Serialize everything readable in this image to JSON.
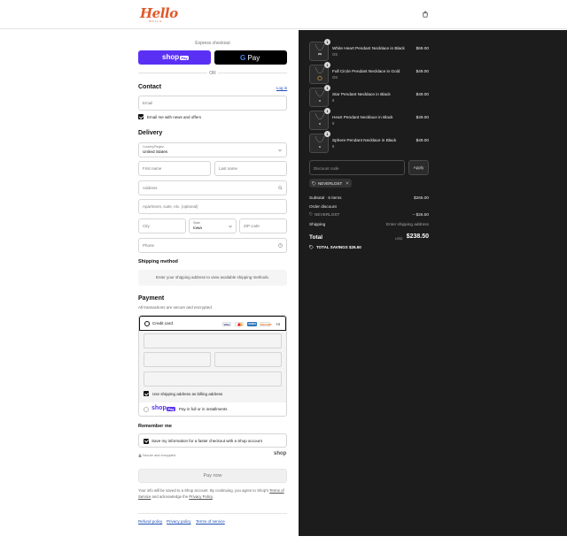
{
  "header": {
    "logo_text": "Hello",
    "logo_sub": "MOLLA",
    "cart_icon": "shopping-bag-icon"
  },
  "express": {
    "label": "Express checkout",
    "shop_label": "shop",
    "shop_chip": "Pay",
    "gpay_label": "Pay",
    "or_label": "OR"
  },
  "contact": {
    "title": "Contact",
    "login_link": "Log in",
    "email_placeholder": "Email",
    "newsletter_label": "Email me with news and offers"
  },
  "delivery": {
    "title": "Delivery",
    "country_label": "Country/Region",
    "country_value": "United States",
    "first_name_placeholder": "First name",
    "last_name_placeholder": "Last name",
    "address_placeholder": "Address",
    "apartment_placeholder": "Apartment, suite, etc. (optional)",
    "city_placeholder": "City",
    "state_label": "State",
    "state_value": "Iowa",
    "zip_placeholder": "ZIP code",
    "phone_placeholder": "Phone"
  },
  "shipping": {
    "title": "Shipping method",
    "message": "Enter your shipping address to view available shipping methods."
  },
  "payment": {
    "title": "Payment",
    "subtitle": "All transactions are secure and encrypted.",
    "credit_card_label": "Credit card",
    "more_cards": "+4",
    "brands": [
      "VISA",
      "MC",
      "AMEX",
      "DISCOVER"
    ],
    "billing_label": "Use shipping address as billing address",
    "shop_pay_label": "Pay in full or in installments",
    "shop_word": "shop",
    "shop_chip": "Pay"
  },
  "remember": {
    "title": "Remember me",
    "save_label": "Save my information for a faster checkout with a Shop account",
    "secure_label": "Secure and encrypted",
    "shop_word": "shop"
  },
  "pay_button": "Pay now",
  "legal": {
    "text_1": "Your info will be saved to a Shop account. By continuing, you agree to Shop's",
    "terms_link": "Terms of Service",
    "text_2": "and acknowledge the",
    "privacy_link": "Privacy Policy",
    "text_3": "."
  },
  "footer": {
    "links": [
      "Refund policy",
      "Privacy policy",
      "Terms of service"
    ]
  },
  "cart": {
    "items": [
      {
        "qty": "1",
        "name": "White Heart Pendant Necklace in Black",
        "variant": "OS",
        "price": "$69.00"
      },
      {
        "qty": "1",
        "name": "Full Circle Pendant Necklace in Gold",
        "variant": "OS",
        "price": "$49.00"
      },
      {
        "qty": "1",
        "name": "Star Pendant Necklace in Black",
        "variant": "8",
        "price": "$49.00"
      },
      {
        "qty": "1",
        "name": "Heart Pendant Necklace in Black",
        "variant": "8",
        "price": "$49.00"
      },
      {
        "qty": "1",
        "name": "Sphere Pendant Necklace in Black",
        "variant": "8",
        "price": "$49.00"
      }
    ],
    "discount_placeholder": "Discount code",
    "apply_label": "Apply",
    "applied_code": "NEVERLOST",
    "subtotal_label": "Subtotal · 5 items",
    "subtotal_value": "$265.00",
    "order_discount_label": "Order discount",
    "discount_code_label": "NEVERLOST",
    "discount_value": "– $26.50",
    "shipping_label": "Shipping",
    "shipping_value": "Enter shipping address",
    "total_label": "Total",
    "currency": "USD",
    "total_value": "$238.50",
    "savings_label": "TOTAL SAVINGS",
    "savings_value": "$26.50"
  },
  "colors": {
    "brand": "#e0582b",
    "shop_pay": "#5a31f4",
    "summary_bg": "#1c1c1c",
    "link": "#1f4fb4"
  }
}
